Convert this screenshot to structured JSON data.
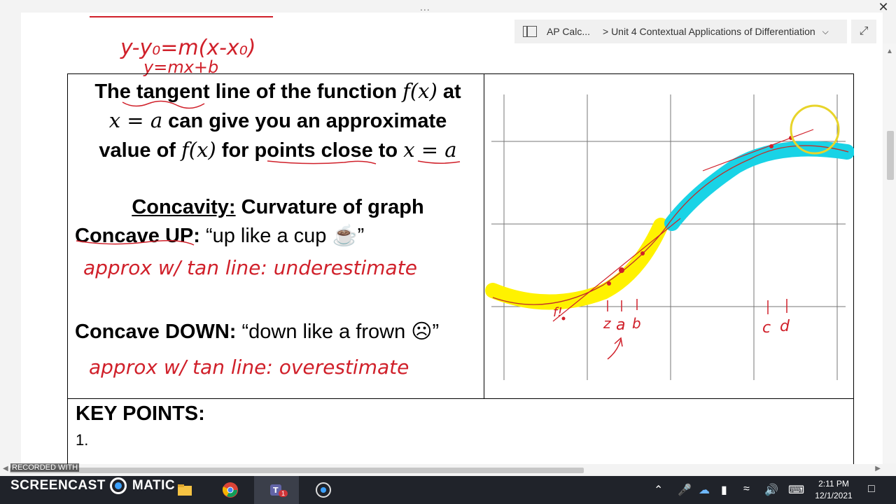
{
  "window": {
    "menu_dots": "...",
    "close_symbol": "✕"
  },
  "breadcrumb": {
    "notebook_icon": "notebook-icon",
    "crumb1": "AP Calc...",
    "crumb2": "> Unit 4 Contextual Applications of Differentiation",
    "chevron_icon": "chevron-down-icon",
    "expand_icon": "expand-icon"
  },
  "notes": {
    "tangent_line": {
      "line1_a": "The tangent line of the function ",
      "line1_math": "f(x)",
      "line1_b": " at",
      "line2_math": "x = a",
      "line2_b": " can give you an approximate",
      "line3_a": "value of ",
      "line3_math": "f(x)",
      "line3_b": " for points close to ",
      "line3_math2": "x = a"
    },
    "concavity_title": "Concavity:",
    "concavity_desc": " Curvature of graph",
    "concave_up_label": "Concave UP:",
    "concave_up_text": " “up like a cup ☕”",
    "concave_down_label": "Concave DOWN:",
    "concave_down_text": " “down like a frown ☹”",
    "key_points_title": "KEY POINTS:",
    "item1": "1."
  },
  "handwriting": {
    "point_slope": "y-y₀=m(x-x₀)",
    "slope_intercept": "y=mx+b",
    "up_approx": "approx w/ tan line: underestimate",
    "down_approx": "approx w/ tan line: overestimate",
    "graph_labels": [
      "f!",
      "z",
      "a",
      "b",
      "c",
      "d"
    ]
  },
  "taskbar": {
    "recorded_with": "RECORDED WITH",
    "screencast": "SCREENCAST",
    "matic": "MATIC",
    "time": "2:11 PM",
    "date": "12/1/2021",
    "icons": [
      "windows-icon",
      "search-icon",
      "task-view-icon",
      "file-explorer-icon",
      "chrome-icon",
      "teams-icon",
      "screencast-icon"
    ],
    "teams_badge": "1"
  },
  "colors": {
    "ink_red": "#d0202a",
    "highlight_yellow": "#fff200",
    "highlight_cyan": "#19d3e6",
    "taskbar": "#20232a"
  }
}
